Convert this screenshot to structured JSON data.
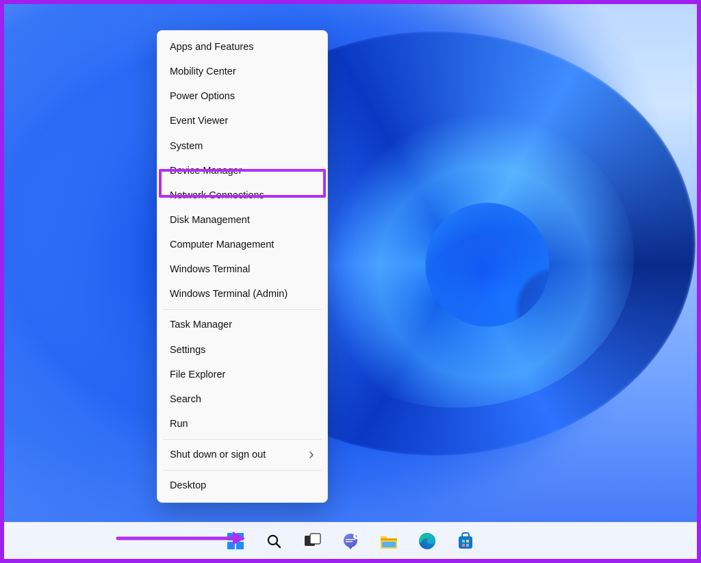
{
  "annotation": {
    "highlight_color": "#b130f0",
    "frame_color": "#a020f0",
    "highlighted_item_index": 5
  },
  "context_menu": {
    "groups": [
      {
        "items": [
          {
            "id": "apps-features",
            "label": "Apps and Features"
          },
          {
            "id": "mobility-center",
            "label": "Mobility Center"
          },
          {
            "id": "power-options",
            "label": "Power Options"
          },
          {
            "id": "event-viewer",
            "label": "Event Viewer"
          },
          {
            "id": "system",
            "label": "System"
          },
          {
            "id": "device-manager",
            "label": "Device Manager"
          },
          {
            "id": "network-connections",
            "label": "Network Connections"
          },
          {
            "id": "disk-management",
            "label": "Disk Management"
          },
          {
            "id": "computer-management",
            "label": "Computer Management"
          },
          {
            "id": "windows-terminal",
            "label": "Windows Terminal"
          },
          {
            "id": "windows-terminal-admin",
            "label": "Windows Terminal (Admin)"
          }
        ]
      },
      {
        "items": [
          {
            "id": "task-manager",
            "label": "Task Manager"
          },
          {
            "id": "settings",
            "label": "Settings"
          },
          {
            "id": "file-explorer",
            "label": "File Explorer"
          },
          {
            "id": "search",
            "label": "Search"
          },
          {
            "id": "run",
            "label": "Run"
          }
        ]
      },
      {
        "items": [
          {
            "id": "shut-down-sign-out",
            "label": "Shut down or sign out",
            "submenu": true
          }
        ]
      },
      {
        "items": [
          {
            "id": "desktop",
            "label": "Desktop"
          }
        ]
      }
    ]
  },
  "taskbar": {
    "items": [
      {
        "id": "start",
        "name": "Start",
        "icon": "start-icon"
      },
      {
        "id": "search",
        "name": "Search",
        "icon": "search-icon"
      },
      {
        "id": "task-view",
        "name": "Task View",
        "icon": "taskview-icon"
      },
      {
        "id": "chat",
        "name": "Chat",
        "icon": "chat-icon"
      },
      {
        "id": "file-explorer",
        "name": "File Explorer",
        "icon": "explorer-icon"
      },
      {
        "id": "edge",
        "name": "Microsoft Edge",
        "icon": "edge-icon"
      },
      {
        "id": "store",
        "name": "Microsoft Store",
        "icon": "store-icon"
      }
    ]
  }
}
